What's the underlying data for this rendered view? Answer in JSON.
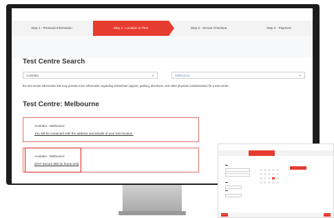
{
  "steps": [
    {
      "label": "Step 1 - Personal Information",
      "active": false
    },
    {
      "label": "Step 2 - Location & Time",
      "active": true
    },
    {
      "label": "Step 3 - Secure Checkout",
      "active": false
    },
    {
      "label": "Step 4 - Payment",
      "active": false
    }
  ],
  "search": {
    "title": "Test Centre Search",
    "country_value": "Australia",
    "city_value": "Melbourne",
    "note": "the test centre information link may provide more information regarding wheelchair support, parking, directions, and other physical considerations for a test centre."
  },
  "centre": {
    "title": "Test Centre: Melbourne",
    "cards": [
      {
        "name": "Australia - Melbourne",
        "link": "You will be contacted with the address and details of your test location."
      },
      {
        "name": "Australia - Melbourne",
        "link": "(DAT Secure 360 (in home test)"
      }
    ]
  },
  "colors": {
    "accent": "#e63c2f",
    "highlight": "#d81e1e",
    "card_border": "#e86c62"
  }
}
